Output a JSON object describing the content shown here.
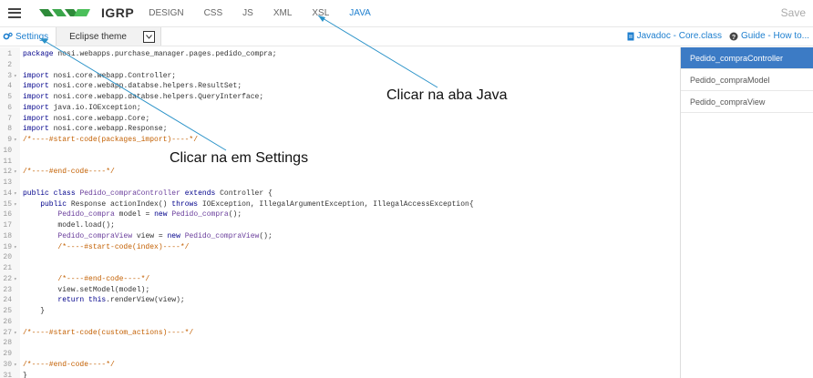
{
  "header": {
    "logo_text": "IGRP",
    "tabs": [
      "DESIGN",
      "CSS",
      "JS",
      "XML",
      "XSL",
      "JAVA"
    ],
    "active_tab": "JAVA",
    "save_label": "Save"
  },
  "toolbar": {
    "settings_label": "Settings",
    "theme_label": "Eclipse theme",
    "javadoc_label": "Javadoc - Core.class",
    "guide_label": "Guide - How to..."
  },
  "sidebar": {
    "items": [
      "Pedido_compraController",
      "Pedido_compraModel",
      "Pedido_compraView"
    ],
    "active": "Pedido_compraController"
  },
  "code_lines": [
    "package nosi.webapps.purchase_manager.pages.pedido_compra;",
    "",
    "import nosi.core.webapp.Controller;",
    "import nosi.core.webapp.databse.helpers.ResultSet;",
    "import nosi.core.webapp.databse.helpers.QueryInterface;",
    "import java.io.IOException;",
    "import nosi.core.webapp.Core;",
    "import nosi.core.webapp.Response;",
    "/*----#start-code(packages_import)----*/",
    "",
    "",
    "/*----#end-code----*/",
    "",
    "public class Pedido_compraController extends Controller {",
    "    public Response actionIndex() throws IOException, IllegalArgumentException, IllegalAccessException{",
    "        Pedido_compra model = new Pedido_compra();",
    "        model.load();",
    "        Pedido_compraView view = new Pedido_compraView();",
    "        /*----#start-code(index)----*/",
    "",
    "",
    "        /*----#end-code----*/",
    "        view.setModel(model);",
    "        return this.renderView(view);",
    "    }",
    "",
    "/*----#start-code(custom_actions)----*/",
    "",
    "",
    "/*----#end-code----*/",
    "}"
  ],
  "annotations": {
    "java_tab": "Clicar na aba Java",
    "settings": "Clicar na em Settings"
  },
  "colors": {
    "accent": "#1e7fcf",
    "sidebar_active": "#3c7bc5",
    "keyword": "#00008b",
    "comment": "#c35f00"
  }
}
